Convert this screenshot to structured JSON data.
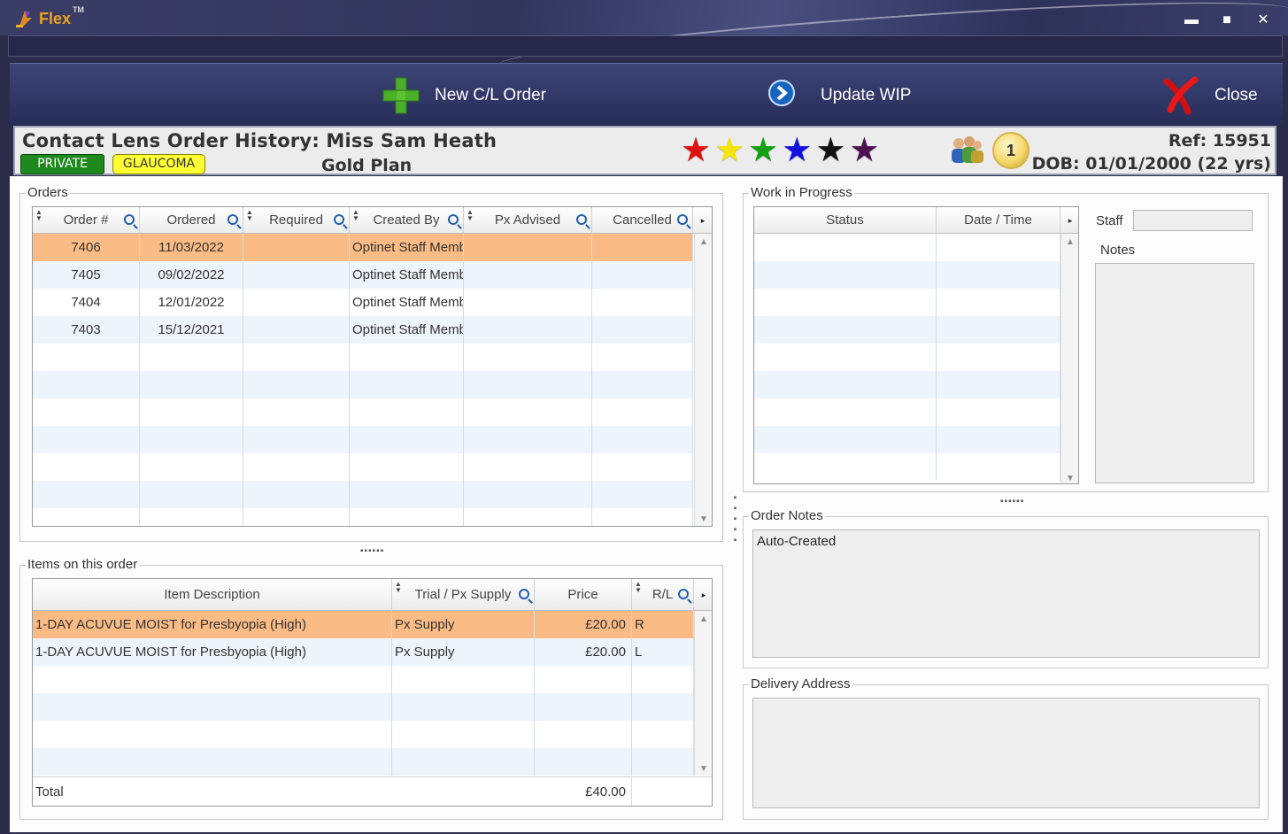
{
  "app": {
    "name": "Flex",
    "trademark": "TM"
  },
  "window_controls": {
    "minimize": "▬",
    "maximize": "■",
    "close": "✕"
  },
  "toolbar": {
    "new_order_label": "New C/L Order",
    "update_wip_label": "Update WIP",
    "close_label": "Close"
  },
  "header": {
    "title": "Contact Lens Order History: Miss Sam Heath",
    "badges": {
      "private": "PRIVATE",
      "glaucoma": "GLAUCOMA"
    },
    "plan": "Gold Plan",
    "stars": [
      {
        "glyph": "★",
        "color": "#e01010"
      },
      {
        "glyph": "★",
        "color": "#f4e600"
      },
      {
        "glyph": "★",
        "color": "#10a010"
      },
      {
        "glyph": "★",
        "color": "#1010e0"
      },
      {
        "glyph": "★",
        "color": "#111111"
      },
      {
        "glyph": "★",
        "color": "#4a1050"
      }
    ],
    "coin_count": "1",
    "ref": "Ref: 15951",
    "dob": "DOB: 01/01/2000 (22 yrs)"
  },
  "orders": {
    "group_label": "Orders",
    "columns": [
      "Order #",
      "Ordered",
      "Required",
      "Created By",
      "Px Advised",
      "Cancelled"
    ],
    "rows": [
      [
        "7406",
        "11/03/2022",
        "",
        "Optinet Staff Member",
        "",
        ""
      ],
      [
        "7405",
        "09/02/2022",
        "",
        "Optinet Staff Member",
        "",
        ""
      ],
      [
        "7404",
        "12/01/2022",
        "",
        "Optinet Staff Member",
        "",
        ""
      ],
      [
        "7403",
        "15/12/2021",
        "",
        "Optinet Staff Member",
        "",
        ""
      ]
    ],
    "selected_row": 0
  },
  "items": {
    "group_label": "Items on this order",
    "columns": [
      "Item Description",
      "Trial / Px Supply",
      "Price",
      "R/L"
    ],
    "rows": [
      [
        "1-DAY ACUVUE MOIST for Presbyopia (High)",
        "Px Supply",
        "£20.00",
        "R"
      ],
      [
        "1-DAY ACUVUE MOIST for Presbyopia (High)",
        "Px Supply",
        "£20.00",
        "L"
      ]
    ],
    "selected_row": 0,
    "total_label": "Total",
    "total_value": "£40.00"
  },
  "wip": {
    "group_label": "Work in Progress",
    "columns": [
      "Status",
      "Date / Time"
    ],
    "staff_label": "Staff",
    "staff_value": "",
    "notes_label": "Notes"
  },
  "order_notes": {
    "group_label": "Order Notes",
    "text": "Auto-Created"
  },
  "delivery": {
    "group_label": "Delivery Address",
    "text": ""
  }
}
